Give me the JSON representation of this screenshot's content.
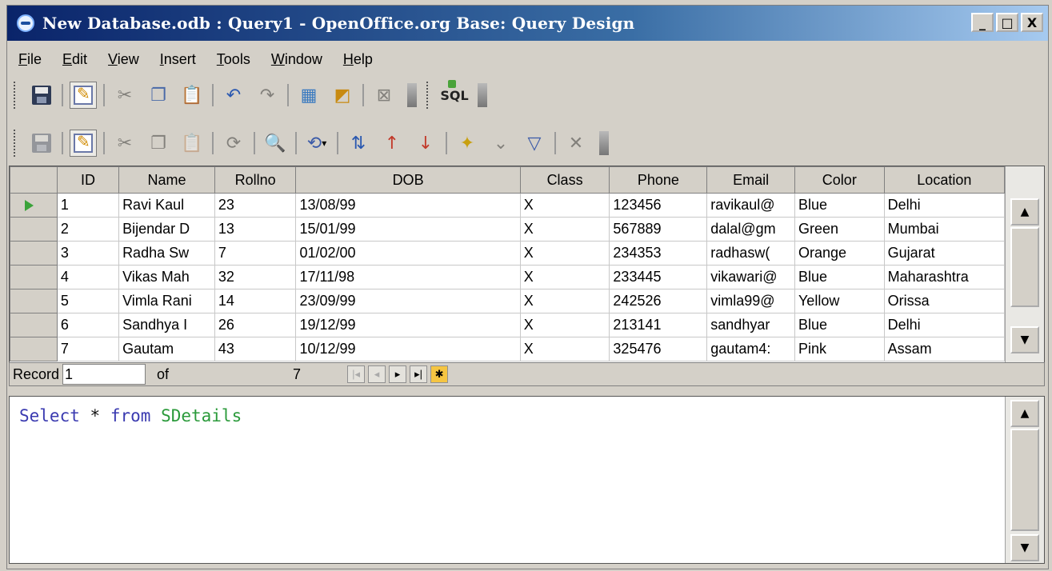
{
  "window": {
    "title": "New Database.odb : Query1 - OpenOffice.org Base: Query Design"
  },
  "window_buttons": [
    "_",
    "□",
    "X"
  ],
  "menu": [
    {
      "accel": "F",
      "rest": "ile"
    },
    {
      "accel": "E",
      "rest": "dit"
    },
    {
      "accel": "V",
      "rest": "iew"
    },
    {
      "accel": "I",
      "rest": "nsert"
    },
    {
      "accel": "T",
      "rest": "ools"
    },
    {
      "accel": "W",
      "rest": "indow"
    },
    {
      "accel": "H",
      "rest": "elp"
    }
  ],
  "toolbar1": {
    "icons": [
      "save-icon",
      "edit-icon",
      "cut-icon",
      "copy-icon",
      "paste-icon",
      "undo-icon",
      "redo-icon",
      "add-tables-icon",
      "design-view-icon",
      "functions-icon",
      "sql-icon"
    ],
    "sql_label": "SQL"
  },
  "toolbar2": {
    "icons": [
      "save-record-icon",
      "edit-data-icon",
      "cut-icon",
      "copy-icon",
      "paste-icon",
      "find-record-icon",
      "refresh-icon",
      "sort-ascending-icon",
      "sort-descending-icon",
      "sort-icon",
      "autofilter-icon",
      "standard-filter-icon",
      "apply-filter-icon",
      "remove-filter-icon"
    ]
  },
  "grid": {
    "columns": [
      "ID",
      "Name",
      "Rollno",
      "DOB",
      "Class",
      "Phone",
      "Email",
      "Color",
      "Location"
    ],
    "rows": [
      [
        "1",
        "Ravi Kaul",
        "23",
        "13/08/99",
        "X",
        "123456",
        "ravikaul@",
        "Blue",
        "Delhi"
      ],
      [
        "2",
        "Bijendar D",
        "13",
        "15/01/99",
        "X",
        "567889",
        "dalal@gm",
        "Green",
        "Mumbai"
      ],
      [
        "3",
        "Radha Sw",
        "7",
        "01/02/00",
        "X",
        "234353",
        "radhasw(",
        "Orange",
        "Gujarat"
      ],
      [
        "4",
        "Vikas Mah",
        "32",
        "17/11/98",
        "X",
        "233445",
        "vikawari@",
        "Blue",
        "Maharashtra"
      ],
      [
        "5",
        "Vimla Rani",
        "14",
        "23/09/99",
        "X",
        "242526",
        "vimla99@",
        "Yellow",
        "Orissa"
      ],
      [
        "6",
        "Sandhya I",
        "26",
        "19/12/99",
        "X",
        "213141",
        "sandhyar",
        "Blue",
        "Delhi"
      ],
      [
        "7",
        "Gautam",
        "43",
        "10/12/99",
        "X",
        "325476",
        "gautam4:",
        "Pink",
        "Assam"
      ]
    ],
    "current_row": 1
  },
  "navigator": {
    "record_label": "Record",
    "record_value": "1",
    "of_label": "of",
    "total": "7"
  },
  "sql": {
    "keyword_select": "Select",
    "star": "*",
    "keyword_from": "from",
    "table": "SDetails"
  }
}
